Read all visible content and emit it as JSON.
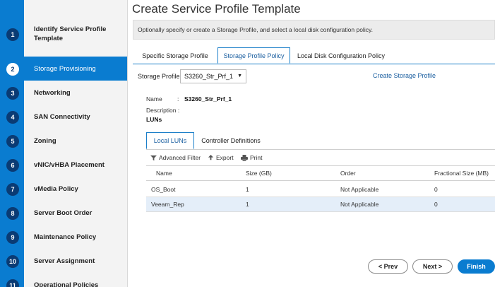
{
  "wizard": {
    "title": "Create Service Profile Template",
    "info": "Optionally specify or create a Storage Profile, and select a local disk configuration policy."
  },
  "steps": [
    {
      "num": "1",
      "label": "Identify Service Profile Template"
    },
    {
      "num": "2",
      "label": "Storage Provisioning"
    },
    {
      "num": "3",
      "label": "Networking"
    },
    {
      "num": "4",
      "label": "SAN Connectivity"
    },
    {
      "num": "5",
      "label": "Zoning"
    },
    {
      "num": "6",
      "label": "vNIC/vHBA Placement"
    },
    {
      "num": "7",
      "label": "vMedia Policy"
    },
    {
      "num": "8",
      "label": "Server Boot Order"
    },
    {
      "num": "9",
      "label": "Maintenance Policy"
    },
    {
      "num": "10",
      "label": "Server Assignment"
    },
    {
      "num": "11",
      "label": "Operational Policies"
    }
  ],
  "active_step": "2",
  "tabs": [
    "Specific Storage Profile",
    "Storage Profile Policy",
    "Local Disk Configuration Policy"
  ],
  "active_tab": "Storage Profile Policy",
  "storage_profile": {
    "label": "Storage Profile:",
    "selected": "S3260_Str_Prf_1",
    "create_link": "Create Storage Profile"
  },
  "details": {
    "name_key": "Name",
    "name_sep": ":",
    "name_value": "S3260_Str_Prf_1",
    "description_key": "Description :",
    "luns_heading": "LUNs"
  },
  "subtabs": [
    "Local LUNs",
    "Controller Definitions"
  ],
  "active_subtab": "Local LUNs",
  "toolbar": {
    "filter": "Advanced Filter",
    "export": "Export",
    "print": "Print"
  },
  "table": {
    "columns": [
      "Name",
      "Size (GB)",
      "Order",
      "Fractional Size (MB)"
    ],
    "rows": [
      [
        "OS_Boot",
        "1",
        "Not Applicable",
        "0"
      ],
      [
        "Veeam_Rep",
        "1",
        "Not Applicable",
        "0"
      ]
    ],
    "selected_row": 1
  },
  "buttons": {
    "prev": "< Prev",
    "next": "Next >",
    "finish": "Finish"
  },
  "colors": {
    "accent": "#0a7cd0",
    "step_circle": "#0a3b74",
    "link": "#1b5fa0",
    "selected_row": "#e4eef9"
  }
}
